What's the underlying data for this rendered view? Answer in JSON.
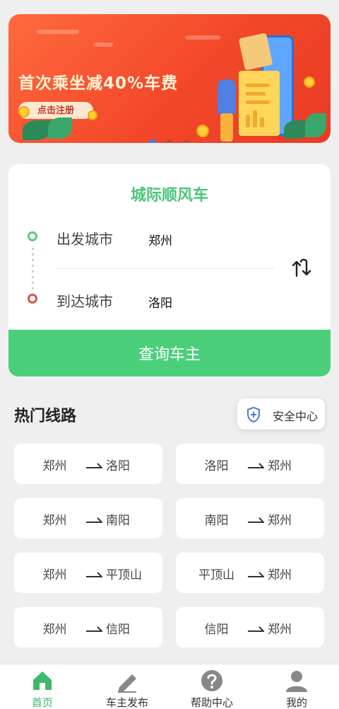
{
  "banner": {
    "headline": "首次乘坐减40%车费",
    "button_label": "点击注册",
    "active_dot_color": "#3a7bf0"
  },
  "search_card": {
    "title": "城际顺风车",
    "depart_label": "出发城市",
    "depart_value": "郑州",
    "arrive_label": "到达城市",
    "arrive_value": "洛阳",
    "search_button": "查询车主",
    "accent": "#4bcf7b"
  },
  "hot_routes": {
    "title": "热门线路",
    "safety_center": "安全中心",
    "routes": [
      {
        "from": "郑州",
        "to": "洛阳"
      },
      {
        "from": "洛阳",
        "to": "郑州"
      },
      {
        "from": "郑州",
        "to": "南阳"
      },
      {
        "from": "南阳",
        "to": "郑州"
      },
      {
        "from": "郑州",
        "to": "平顶山"
      },
      {
        "from": "平顶山",
        "to": "郑州"
      },
      {
        "from": "郑州",
        "to": "信阳"
      },
      {
        "from": "信阳",
        "to": "郑州"
      }
    ]
  },
  "tabbar": {
    "items": [
      {
        "label": "首页",
        "icon": "home-icon"
      },
      {
        "label": "车主发布",
        "icon": "pencil-icon"
      },
      {
        "label": "帮助中心",
        "icon": "question-icon"
      },
      {
        "label": "我的",
        "icon": "user-icon"
      }
    ],
    "active_color": "#3db96b"
  }
}
